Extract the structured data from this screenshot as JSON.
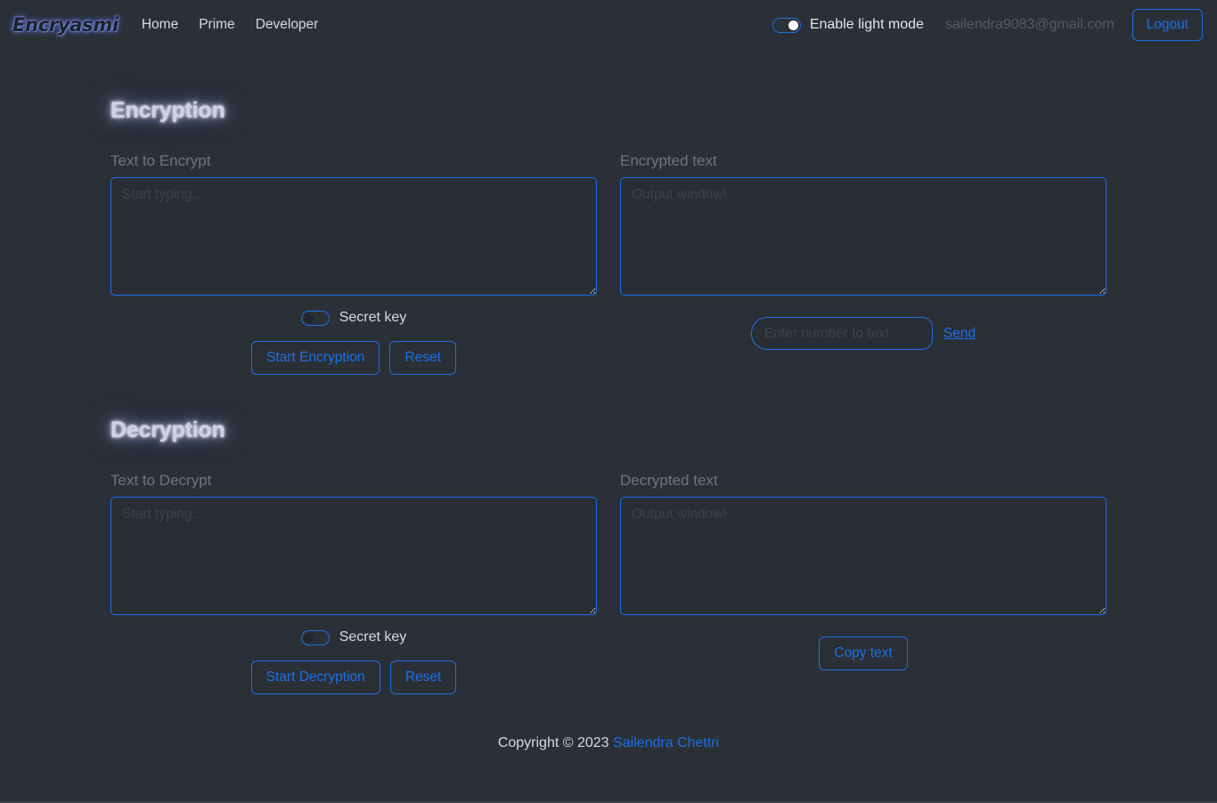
{
  "navbar": {
    "logo": "Encryasmi",
    "links": [
      {
        "label": "Home"
      },
      {
        "label": "Prime"
      },
      {
        "label": "Developer"
      }
    ],
    "light_mode_label": "Enable light mode",
    "light_mode_on": true,
    "email": "sailendra9083@gmail.com",
    "logout_label": "Logout"
  },
  "encryption": {
    "title": "Encryption",
    "input_label": "Text to Encrypt",
    "input_placeholder": "Start typing...",
    "input_value": "",
    "output_label": "Encrypted text",
    "output_placeholder": "Output window!",
    "output_value": "",
    "secret_key_label": "Secret key",
    "secret_key_on": false,
    "start_label": "Start Encryption",
    "reset_label": "Reset",
    "number_placeholder": "Enter number to text",
    "number_value": "",
    "send_label": "Send"
  },
  "decryption": {
    "title": "Decryption",
    "input_label": "Text to Decrypt",
    "input_placeholder": "Start typing...",
    "input_value": "",
    "output_label": "Decrypted text",
    "output_placeholder": "Output window!",
    "output_value": "",
    "secret_key_label": "Secret key",
    "secret_key_on": false,
    "start_label": "Start Decryption",
    "reset_label": "Reset",
    "copy_label": "Copy text"
  },
  "footer": {
    "copyright": "Copyright © 2023",
    "author": "Sailendra Chettri"
  },
  "colors": {
    "background": "#2b3036",
    "accent_blue": "#1a6fe8",
    "text_light": "#d6d9e6",
    "text_muted": "#6e7580"
  }
}
